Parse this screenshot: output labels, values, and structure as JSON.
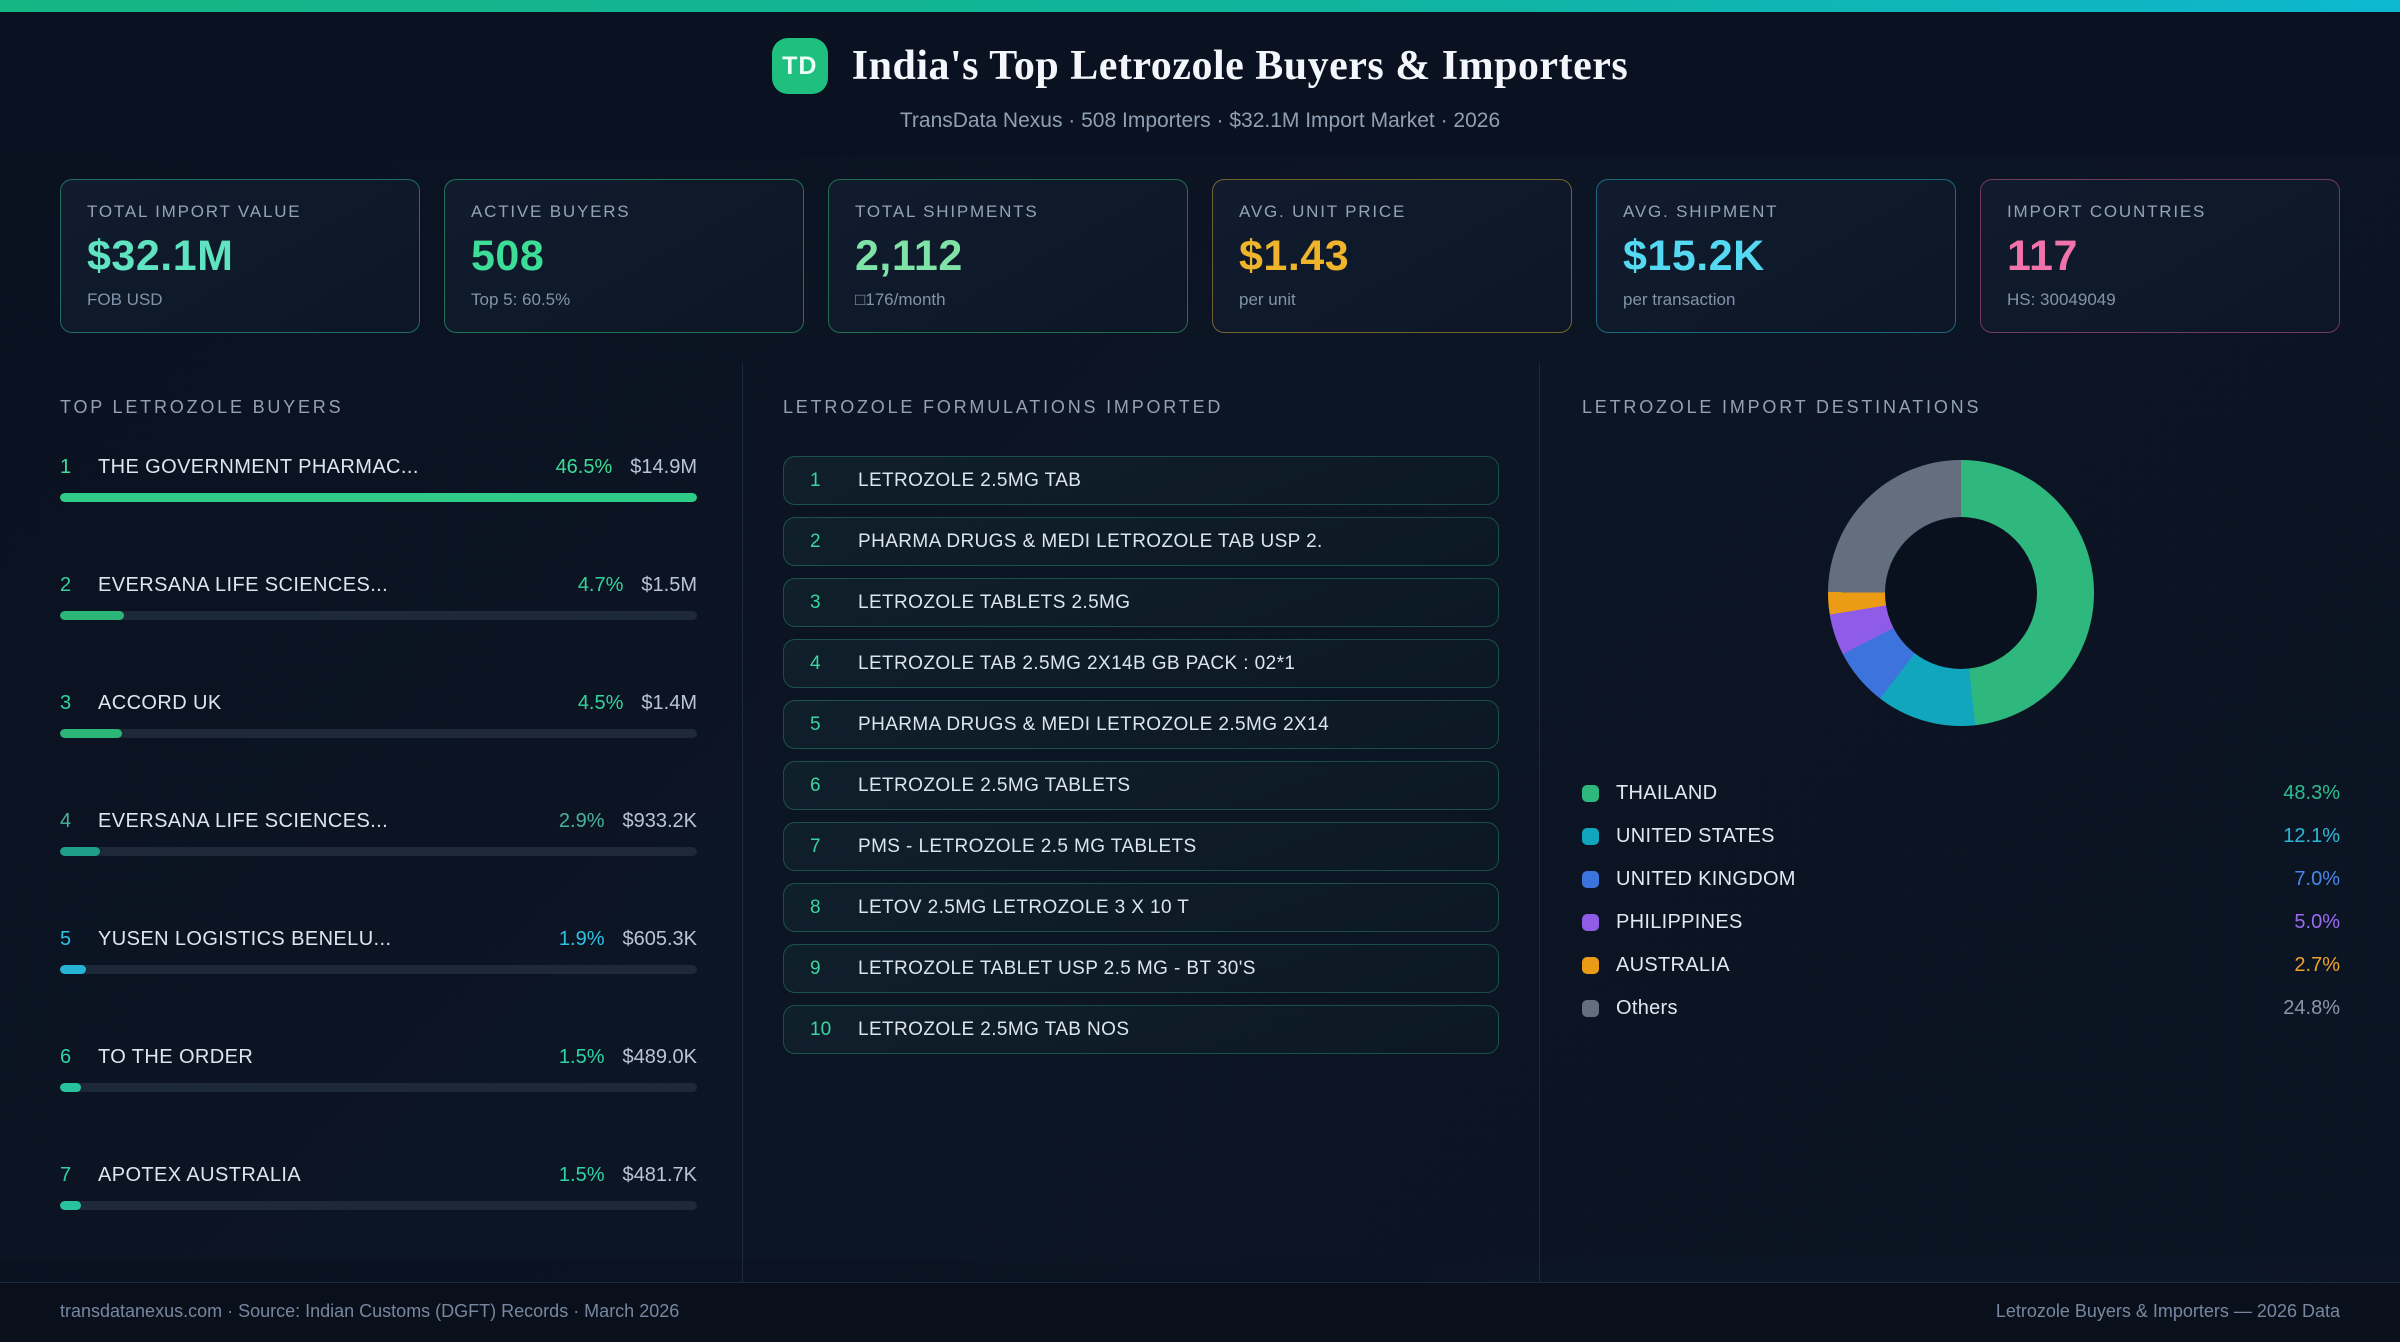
{
  "accent": {
    "bar_left": "#16b584",
    "bar_right": "#0db7cf"
  },
  "header": {
    "badge": "TD",
    "title": "India's Top Letrozole Buyers & Importers",
    "subtitle": "TransData Nexus · 508 Importers · $32.1M Import Market · 2026"
  },
  "stats": [
    {
      "label": "TOTAL IMPORT VALUE",
      "value": "$32.1M",
      "sub": "FOB USD",
      "color": "#5fe3c0",
      "border": "rgba(45,180,150,0.55)"
    },
    {
      "label": "ACTIVE BUYERS",
      "value": "508",
      "sub": "Top 5: 60.5%",
      "color": "#3ddc97",
      "border": "rgba(45,190,130,0.55)"
    },
    {
      "label": "TOTAL SHIPMENTS",
      "value": "2,112",
      "sub": "□176/month",
      "color": "#7fe3a8",
      "border": "rgba(60,190,120,0.50)"
    },
    {
      "label": "AVG. UNIT PRICE",
      "value": "$1.43",
      "sub": "per unit",
      "color": "#f0b42c",
      "border": "rgba(200,160,50,0.55)"
    },
    {
      "label": "AVG. SHIPMENT",
      "value": "$15.2K",
      "sub": "per transaction",
      "color": "#55d9f2",
      "border": "rgba(40,170,200,0.55)"
    },
    {
      "label": "IMPORT COUNTRIES",
      "value": "117",
      "sub": "HS: 30049049",
      "color": "#f273ab",
      "border": "rgba(210,90,150,0.50)"
    }
  ],
  "buyers": {
    "title": "TOP LETROZOLE BUYERS",
    "max_pct": 46.5,
    "items": [
      {
        "rank": "1",
        "name": "THE GOVERNMENT PHARMAC...",
        "pct": 46.5,
        "pct_label": "46.5%",
        "value": "$14.9M",
        "accent": "#3ddc97",
        "bar": "#2ecc87"
      },
      {
        "rank": "2",
        "name": "EVERSANA LIFE SCIENCES...",
        "pct": 4.7,
        "pct_label": "4.7%",
        "value": "$1.5M",
        "accent": "#34d399",
        "bar": "#2bb577"
      },
      {
        "rank": "3",
        "name": "ACCORD UK",
        "pct": 4.5,
        "pct_label": "4.5%",
        "value": "$1.4M",
        "accent": "#34d399",
        "bar": "#2bb577"
      },
      {
        "rank": "4",
        "name": "EVERSANA LIFE SCIENCES...",
        "pct": 2.9,
        "pct_label": "2.9%",
        "value": "$933.2K",
        "accent": "#49b29e",
        "bar": "#1f9e8a"
      },
      {
        "rank": "5",
        "name": "YUSEN LOGISTICS BENELU...",
        "pct": 1.9,
        "pct_label": "1.9%",
        "value": "$605.3K",
        "accent": "#2fc1e4",
        "bar": "#27b3d6"
      },
      {
        "rank": "6",
        "name": "TO THE ORDER",
        "pct": 1.5,
        "pct_label": "1.5%",
        "value": "$489.0K",
        "accent": "#2ed3ab",
        "bar": "#27c39e"
      },
      {
        "rank": "7",
        "name": "APOTEX AUSTRALIA",
        "pct": 1.5,
        "pct_label": "1.5%",
        "value": "$481.7K",
        "accent": "#2ed3ab",
        "bar": "#27c39e"
      }
    ]
  },
  "formulations": {
    "title": "LETROZOLE FORMULATIONS IMPORTED",
    "items": [
      {
        "rank": "1",
        "name": "LETROZOLE 2.5MG TAB"
      },
      {
        "rank": "2",
        "name": "PHARMA DRUGS & MEDI LETROZOLE TAB USP 2."
      },
      {
        "rank": "3",
        "name": "LETROZOLE TABLETS 2.5MG"
      },
      {
        "rank": "4",
        "name": "LETROZOLE TAB 2.5MG 2X14B GB PACK : 02*1"
      },
      {
        "rank": "5",
        "name": "PHARMA DRUGS & MEDI LETROZOLE 2.5MG 2X14"
      },
      {
        "rank": "6",
        "name": "LETROZOLE 2.5MG TABLETS"
      },
      {
        "rank": "7",
        "name": "PMS - LETROZOLE 2.5 MG TABLETS"
      },
      {
        "rank": "8",
        "name": "LETOV 2.5MG LETROZOLE 3 X 10 T"
      },
      {
        "rank": "9",
        "name": "LETROZOLE TABLET USP 2.5 MG - BT 30'S"
      },
      {
        "rank": "10",
        "name": "LETROZOLE 2.5MG TAB NOS"
      }
    ]
  },
  "destinations_title": "LETROZOLE IMPORT DESTINATIONS",
  "chart_data": {
    "type": "pie",
    "subtype": "donut",
    "title": "LETROZOLE IMPORT DESTINATIONS",
    "categories": [
      "THAILAND",
      "UNITED STATES",
      "UNITED KINGDOM",
      "PHILIPPINES",
      "AUSTRALIA",
      "Others"
    ],
    "values": [
      48.3,
      12.1,
      7.0,
      5.0,
      2.7,
      24.8
    ],
    "value_labels": [
      "48.3%",
      "12.1%",
      "7.0%",
      "5.0%",
      "2.7%",
      "24.8%"
    ],
    "colors": [
      "#2eb87d",
      "#12a5be",
      "#3c73dc",
      "#8e5ce6",
      "#eb9b14",
      "#636e7e"
    ],
    "pct_text_colors": [
      "#2fbf8f",
      "#2cb9d6",
      "#4a86e8",
      "#9b6cf0",
      "#f0a32a",
      "#8b95a5"
    ],
    "start_angle_deg": 0,
    "direction": "clockwise",
    "inner_radius_ratio": 0.57,
    "legend_position": "below"
  },
  "footer": {
    "site": "transdatanexus.com",
    "left_rest": " · Source: Indian Customs (DGFT) Records · March 2026",
    "right": "Letrozole Buyers & Importers — 2026 Data"
  }
}
